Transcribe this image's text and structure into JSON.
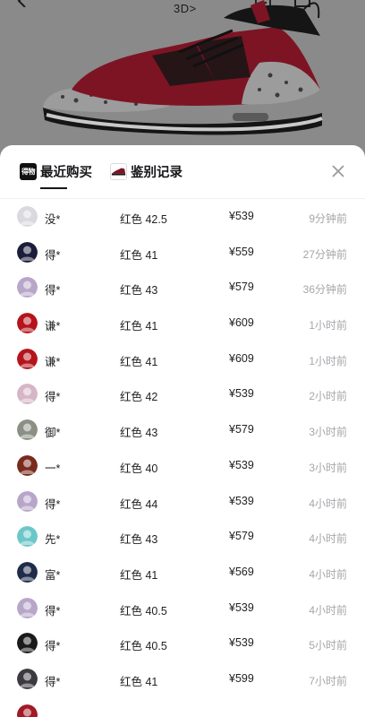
{
  "header": {
    "badge_3d": "3D>"
  },
  "sheet": {
    "tabs": [
      {
        "logo": "得物",
        "label": "最近购买"
      },
      {
        "label": "鉴别记录"
      }
    ]
  },
  "purchases": [
    {
      "name": "没*",
      "spec": "红色 42.5",
      "price": "¥539",
      "time": "9分钟前",
      "avatar_color": "#d9d9de"
    },
    {
      "name": "得*",
      "spec": "红色 41",
      "price": "¥559",
      "time": "27分钟前",
      "avatar_color": "#1b1d3a"
    },
    {
      "name": "得*",
      "spec": "红色 43",
      "price": "¥579",
      "time": "36分钟前",
      "avatar_color": "#b8a6c9"
    },
    {
      "name": "谦*",
      "spec": "红色 41",
      "price": "¥609",
      "time": "1小时前",
      "avatar_color": "#b5141c"
    },
    {
      "name": "谦*",
      "spec": "红色 41",
      "price": "¥609",
      "time": "1小时前",
      "avatar_color": "#b5141c"
    },
    {
      "name": "得*",
      "spec": "红色 42",
      "price": "¥539",
      "time": "2小时前",
      "avatar_color": "#d6b5c6"
    },
    {
      "name": "御*",
      "spec": "红色 43",
      "price": "¥579",
      "time": "3小时前",
      "avatar_color": "#8b8f84"
    },
    {
      "name": "一*",
      "spec": "红色 40",
      "price": "¥539",
      "time": "3小时前",
      "avatar_color": "#7a2a1d"
    },
    {
      "name": "得*",
      "spec": "红色 44",
      "price": "¥539",
      "time": "4小时前",
      "avatar_color": "#b8a6c9"
    },
    {
      "name": "先*",
      "spec": "红色 43",
      "price": "¥579",
      "time": "4小时前",
      "avatar_color": "#6cc7c8"
    },
    {
      "name": "富*",
      "spec": "红色 41",
      "price": "¥569",
      "time": "4小时前",
      "avatar_color": "#1f2c4a"
    },
    {
      "name": "得*",
      "spec": "红色 40.5",
      "price": "¥539",
      "time": "4小时前",
      "avatar_color": "#b8a6c9"
    },
    {
      "name": "得*",
      "spec": "红色 40.5",
      "price": "¥539",
      "time": "5小时前",
      "avatar_color": "#1a1a1a"
    },
    {
      "name": "得*",
      "spec": "红色 41",
      "price": "¥599",
      "time": "7小时前",
      "avatar_color": "#3c3a3e"
    },
    {
      "name": "",
      "spec": "",
      "price": "",
      "time": "",
      "avatar_color": "#a11a24"
    }
  ],
  "colors": {
    "backdrop": "#7f7f7f",
    "sheet": "#ffffff",
    "text": "#222226",
    "muted": "#a6a6ab",
    "shoe_red": "#7d1424",
    "shoe_black": "#151515",
    "cement_grey": "#9c9c9c"
  },
  "icons": [
    "back-arrow-icon",
    "share-icon",
    "cart-icon",
    "close-icon",
    "poizon-logo-icon",
    "shoe-thumbnail-icon"
  ]
}
